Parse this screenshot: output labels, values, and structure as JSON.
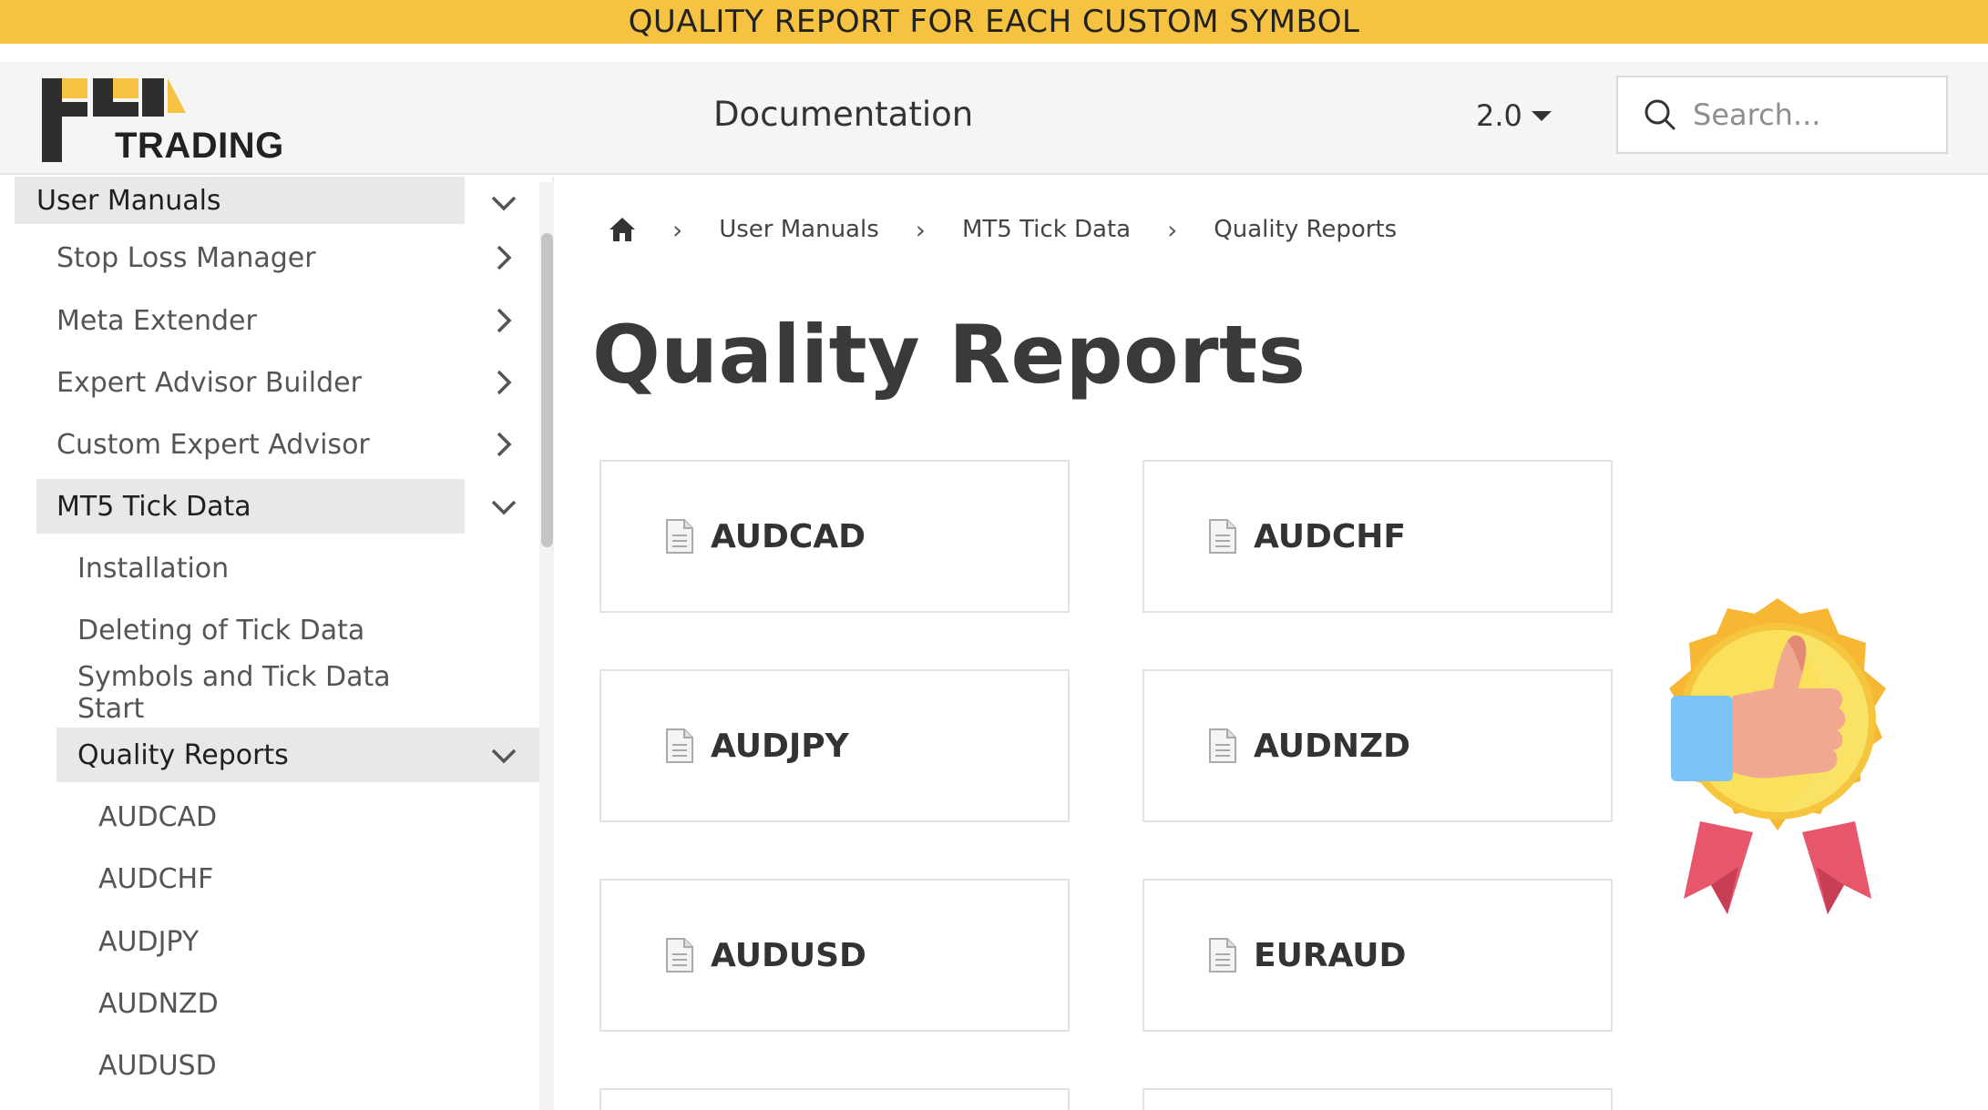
{
  "banner": {
    "text": "QUALITY REPORT FOR EACH CUSTOM SYMBOL"
  },
  "header": {
    "logo_text": "TRADING",
    "title": "Documentation",
    "version": "2.0",
    "search_placeholder": "Search..."
  },
  "sidebar": {
    "items": [
      {
        "label": "User Manuals",
        "level": 0,
        "expanded": true,
        "active": true
      },
      {
        "label": "Stop Loss Manager",
        "level": 1,
        "expanded": false
      },
      {
        "label": "Meta Extender",
        "level": 1,
        "expanded": false
      },
      {
        "label": "Expert Advisor Builder",
        "level": 1,
        "expanded": false
      },
      {
        "label": "Custom Expert Advisor",
        "level": 1,
        "expanded": false
      },
      {
        "label": "MT5 Tick Data",
        "level": 1,
        "expanded": true,
        "active": true
      },
      {
        "label": "Installation",
        "level": 2
      },
      {
        "label": "Deleting of Tick Data",
        "level": 2
      },
      {
        "label": "Symbols and Tick Data Start",
        "level": 2
      },
      {
        "label": "Quality Reports",
        "level": 2,
        "expanded": true,
        "active": true
      },
      {
        "label": "AUDCAD",
        "level": 3
      },
      {
        "label": "AUDCHF",
        "level": 3
      },
      {
        "label": "AUDJPY",
        "level": 3
      },
      {
        "label": "AUDNZD",
        "level": 3
      },
      {
        "label": "AUDUSD",
        "level": 3
      }
    ]
  },
  "breadcrumb": {
    "items": [
      "User Manuals",
      "MT5 Tick Data",
      "Quality Reports"
    ]
  },
  "page": {
    "title": "Quality Reports"
  },
  "cards": [
    "AUDCAD",
    "AUDCHF",
    "AUDJPY",
    "AUDNZD",
    "AUDUSD",
    "EURAUD"
  ],
  "colors": {
    "banner": "#f5c242",
    "active_item": "#e8e8e8",
    "header_bg": "#f5f5f5",
    "badge_gold": "#f7b733",
    "badge_ribbon": "#e8566b",
    "thumb_sleeve": "#7cc4f7",
    "thumb_hand": "#f0a890"
  },
  "icons": {
    "home": "home-icon",
    "search": "search-icon",
    "document": "document-icon",
    "badge": "award-thumbs-up-icon"
  }
}
